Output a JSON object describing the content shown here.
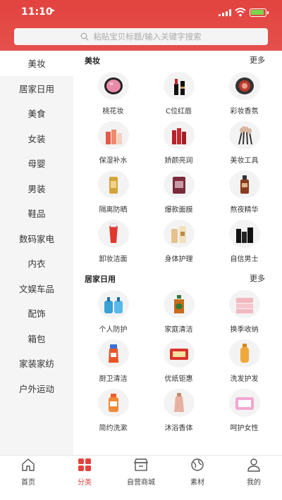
{
  "status": {
    "time": "11:10"
  },
  "search": {
    "placeholder": "粘贴宝贝标题/输入关键字搜索"
  },
  "sidebar": {
    "items": [
      {
        "label": "美妆"
      },
      {
        "label": "居家日用"
      },
      {
        "label": "美食"
      },
      {
        "label": "女装"
      },
      {
        "label": "母婴"
      },
      {
        "label": "男装"
      },
      {
        "label": "鞋品"
      },
      {
        "label": "数码家电"
      },
      {
        "label": "内衣"
      },
      {
        "label": "文娱车品"
      },
      {
        "label": "配饰"
      },
      {
        "label": "箱包"
      },
      {
        "label": "家装家纺"
      },
      {
        "label": "户外运动"
      }
    ]
  },
  "sections": [
    {
      "title": "美妆",
      "more": "更多",
      "items": [
        {
          "label": "桃花妆",
          "icon": "blush-compact-icon"
        },
        {
          "label": "C位红唇",
          "icon": "lipstick-icon"
        },
        {
          "label": "彩妆香氛",
          "icon": "eyeshadow-compact-icon"
        },
        {
          "label": "保湿补水",
          "icon": "skincare-bottles-icon"
        },
        {
          "label": "娇颜亮润",
          "icon": "red-skincare-set-icon"
        },
        {
          "label": "美妆工具",
          "icon": "makeup-brushes-icon"
        },
        {
          "label": "隔离防晒",
          "icon": "sunscreen-bottle-icon"
        },
        {
          "label": "爆款面膜",
          "icon": "face-mask-icon"
        },
        {
          "label": "熬夜精华",
          "icon": "serum-bottle-icon"
        },
        {
          "label": "卸妆洁面",
          "icon": "cleanser-tube-icon"
        },
        {
          "label": "身体护理",
          "icon": "body-care-bottles-icon"
        },
        {
          "label": "自信男士",
          "icon": "mens-care-set-icon"
        }
      ]
    },
    {
      "title": "居家日用",
      "more": "更多",
      "items": [
        {
          "label": "个人防护",
          "icon": "sanitizer-bottles-icon"
        },
        {
          "label": "家庭清洁",
          "icon": "disinfectant-bottle-icon"
        },
        {
          "label": "换季收纳",
          "icon": "storage-box-icon"
        },
        {
          "label": "厨卫清洁",
          "icon": "spray-cleaner-icon"
        },
        {
          "label": "优纸钜惠",
          "icon": "tissue-pack-icon"
        },
        {
          "label": "洗发护发",
          "icon": "shampoo-bottle-icon"
        },
        {
          "label": "简约洗漱",
          "icon": "mouthwash-bottle-icon"
        },
        {
          "label": "沐浴香体",
          "icon": "body-wash-bottle-icon"
        },
        {
          "label": "呵护女性",
          "icon": "sanitary-pad-pack-icon"
        }
      ]
    }
  ],
  "tabbar": [
    {
      "label": "首页",
      "icon": "home-icon"
    },
    {
      "label": "分类",
      "icon": "category-grid-icon"
    },
    {
      "label": "自营商城",
      "icon": "store-icon"
    },
    {
      "label": "素材",
      "icon": "globe-icon"
    },
    {
      "label": "我的",
      "icon": "user-icon"
    }
  ],
  "colors": {
    "accent": "#e2433f",
    "sidebar_bg": "#f5f5f5"
  }
}
